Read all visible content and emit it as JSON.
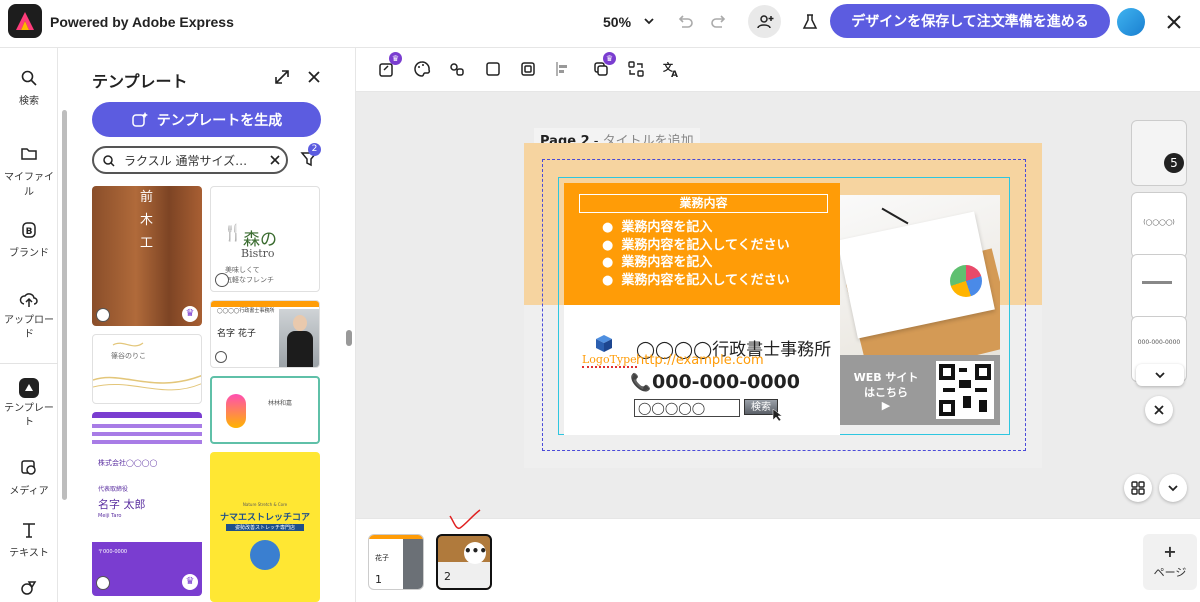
{
  "header": {
    "app_title": "Powered by Adobe Express",
    "zoom": "50%",
    "save_button": "デザインを保存して注文準備を進める"
  },
  "rail": {
    "items": [
      {
        "label": "検索",
        "icon": "search-icon"
      },
      {
        "label": "マイファイル",
        "icon": "folder-icon"
      },
      {
        "label": "ブランド",
        "icon": "brand-icon"
      },
      {
        "label": "アップロード",
        "icon": "upload-icon"
      },
      {
        "label": "テンプレート",
        "icon": "template-icon"
      },
      {
        "label": "メディア",
        "icon": "media-icon"
      },
      {
        "label": "テキスト",
        "icon": "text-icon"
      }
    ]
  },
  "panel": {
    "title": "テンプレート",
    "generate_button": "テンプレートを生成",
    "search_value": "ラクスル 通常サイズ…",
    "filter_count": "2",
    "templates": {
      "t1_lines": [
        "前",
        "木",
        "工"
      ],
      "t2_title": "森の",
      "t2_sub": "Bistro",
      "t2_desc": "美味しくて\n気軽なフレンチ",
      "t3_name": "名字 花子",
      "t3_company": "◯◯◯◯行政書士事務所",
      "t4_name": "篠谷のりこ",
      "t5_name": "林林和嘉",
      "t6_company": "株式会社◯◯◯◯",
      "t6_title": "代表取締役",
      "t6_name": "名字 太郎",
      "t6_romaji": "Meiji Taro",
      "t6_tel": "〒000-0000",
      "t7_title": "ナマエストレッチコア",
      "t7_sub": "Nature Stretch & Core",
      "t7_tag": "姿勢改善ストレッチ専門店"
    }
  },
  "page": {
    "label_prefix": "Page 2",
    "label_suffix": "タイトルを追加"
  },
  "card": {
    "header_box": "業務内容",
    "bullets": [
      "業務内容を記入",
      "業務内容を記入してください",
      "業務内容を記入",
      "業務内容を記入してください"
    ],
    "company": "◯◯◯◯行政書士事務所",
    "url": "http://example.com",
    "logo": "LogoType",
    "phone": "000-000-0000",
    "search_field": "◯◯◯◯◯",
    "search_button": "検索",
    "web_line1": "WEB サイト",
    "web_line2": "はこちら",
    "web_arrow": "▶"
  },
  "right": {
    "badge": "5",
    "thumb2_text": "(◯◯◯◯)",
    "thumb4_text": "000-000-0000"
  },
  "pages": [
    {
      "num": "1",
      "name": "花子"
    },
    {
      "num": "2",
      "name": ""
    }
  ],
  "add_page": {
    "plus": "+",
    "label": "ページ"
  },
  "colors": {
    "accent": "#5c5ce0",
    "orange": "#ff9c07",
    "peach": "#f6d4a0"
  }
}
